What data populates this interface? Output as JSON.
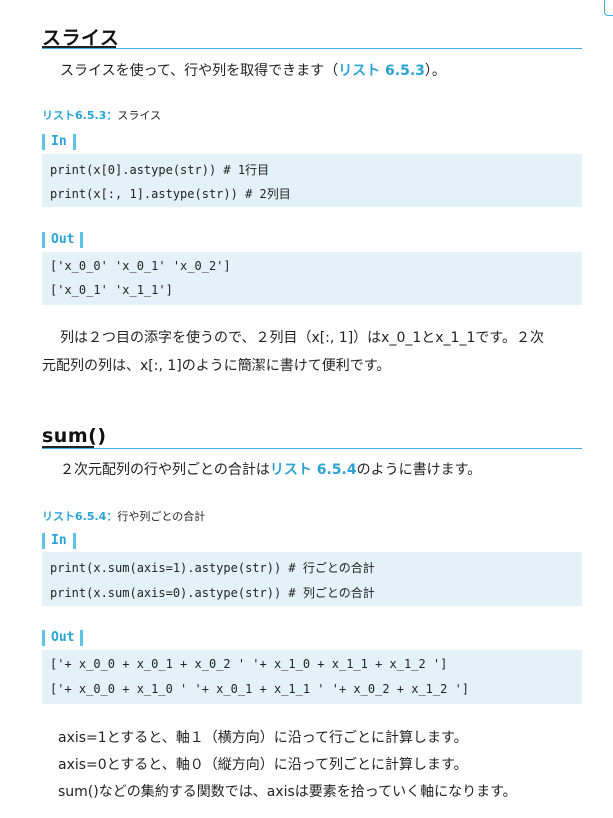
{
  "sections": [
    {
      "heading": "スライス",
      "intro": {
        "before": "スライスを使って、行や列を取得できます（",
        "ref": "リスト 6.5.3",
        "after": "）。"
      },
      "listing": {
        "number": "リスト6.5.3：",
        "title": "スライス"
      },
      "in_label": "In",
      "code": [
        "print(x[0].astype(str))  # 1行目",
        "print(x[:, 1].astype(str))  # 2列目"
      ],
      "out_label": "Out",
      "output": [
        "['x_0_0' 'x_0_1' 'x_0_2']",
        "['x_0_1' 'x_1_1']"
      ],
      "para_lines": [
        "列は２つ目の添字を使うので、２列目（x[:, 1]）はx_0_1とx_1_1です。２次",
        "元配列の列は、x[:, 1]のように簡潔に書けて便利です。"
      ]
    },
    {
      "heading": "sum()",
      "intro": {
        "before": "２次元配列の行や列ごとの合計は",
        "ref": "リスト 6.5.4",
        "after": "のように書けます。"
      },
      "listing": {
        "number": "リスト6.5.4：",
        "title": "行や列ごとの合計"
      },
      "in_label": "In",
      "code": [
        "print(x.sum(axis=1).astype(str))  # 行ごとの合計",
        "print(x.sum(axis=0).astype(str))  # 列ごとの合計"
      ],
      "out_label": "Out",
      "output": [
        "['+ x_0_0 + x_0_1 + x_0_2 ' '+ x_1_0 + x_1_1 + x_1_2 ']",
        "['+ x_0_0 + x_1_0 ' '+ x_0_1 + x_1_1 ' '+ x_0_2 + x_1_2 ']"
      ],
      "para_lines": [
        "axis=1とすると、軸１（横方向）に沿って行ごとに計算します。",
        "axis=0とすると、軸０（縦方向）に沿って列ごとに計算します。",
        "sum()などの集約する関数では、axisは要素を拾っていく軸になります。"
      ]
    }
  ]
}
